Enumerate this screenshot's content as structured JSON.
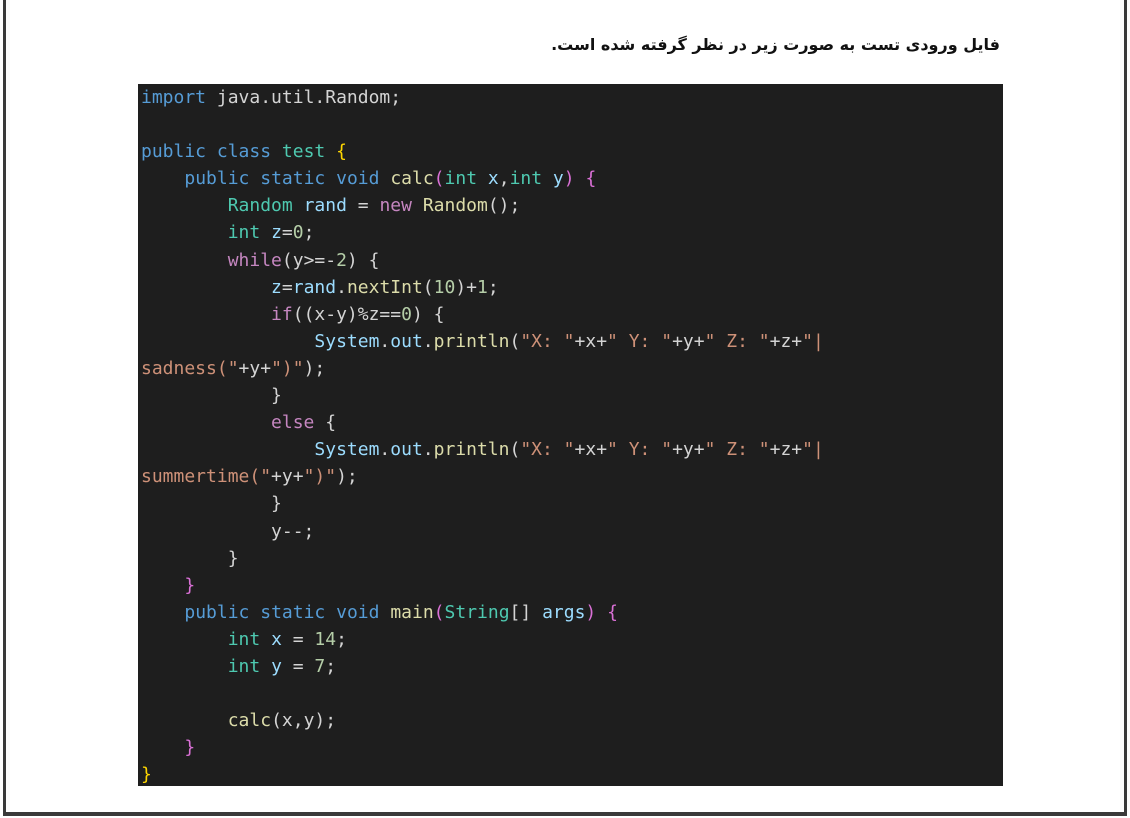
{
  "document": {
    "caption": "فایل ورودی تست به صورت زیر در نظر گرفته شده است."
  },
  "code": {
    "lines": [
      [
        {
          "t": "import",
          "c": "kw"
        },
        {
          "t": " java.util.Random;",
          "c": "punc"
        }
      ],
      [],
      [
        {
          "t": "public",
          "c": "kw"
        },
        {
          "t": " ",
          "c": "punc"
        },
        {
          "t": "class",
          "c": "kw"
        },
        {
          "t": " ",
          "c": "punc"
        },
        {
          "t": "test",
          "c": "type"
        },
        {
          "t": " ",
          "c": "punc"
        },
        {
          "t": "{",
          "c": "brace"
        }
      ],
      [
        {
          "t": "    ",
          "c": "punc"
        },
        {
          "t": "public",
          "c": "kw"
        },
        {
          "t": " ",
          "c": "punc"
        },
        {
          "t": "static",
          "c": "kw"
        },
        {
          "t": " ",
          "c": "punc"
        },
        {
          "t": "void",
          "c": "kw"
        },
        {
          "t": " ",
          "c": "punc"
        },
        {
          "t": "calc",
          "c": "fn"
        },
        {
          "t": "(",
          "c": "paren"
        },
        {
          "t": "int",
          "c": "type"
        },
        {
          "t": " ",
          "c": "punc"
        },
        {
          "t": "x",
          "c": "var"
        },
        {
          "t": ",",
          "c": "punc"
        },
        {
          "t": "int",
          "c": "type"
        },
        {
          "t": " ",
          "c": "punc"
        },
        {
          "t": "y",
          "c": "var"
        },
        {
          "t": ")",
          "c": "paren"
        },
        {
          "t": " ",
          "c": "punc"
        },
        {
          "t": "{",
          "c": "paren"
        }
      ],
      [
        {
          "t": "        ",
          "c": "punc"
        },
        {
          "t": "Random",
          "c": "type"
        },
        {
          "t": " ",
          "c": "punc"
        },
        {
          "t": "rand",
          "c": "var"
        },
        {
          "t": " = ",
          "c": "punc"
        },
        {
          "t": "new",
          "c": "ctrl"
        },
        {
          "t": " ",
          "c": "punc"
        },
        {
          "t": "Random",
          "c": "fn"
        },
        {
          "t": "();",
          "c": "punc"
        }
      ],
      [
        {
          "t": "        ",
          "c": "punc"
        },
        {
          "t": "int",
          "c": "type"
        },
        {
          "t": " ",
          "c": "punc"
        },
        {
          "t": "z",
          "c": "var"
        },
        {
          "t": "=",
          "c": "punc"
        },
        {
          "t": "0",
          "c": "num"
        },
        {
          "t": ";",
          "c": "punc"
        }
      ],
      [
        {
          "t": "        ",
          "c": "punc"
        },
        {
          "t": "while",
          "c": "ctrl"
        },
        {
          "t": "(y>=-",
          "c": "punc"
        },
        {
          "t": "2",
          "c": "num"
        },
        {
          "t": ") {",
          "c": "punc"
        }
      ],
      [
        {
          "t": "            ",
          "c": "punc"
        },
        {
          "t": "z",
          "c": "var"
        },
        {
          "t": "=",
          "c": "punc"
        },
        {
          "t": "rand",
          "c": "var"
        },
        {
          "t": ".",
          "c": "punc"
        },
        {
          "t": "nextInt",
          "c": "fn"
        },
        {
          "t": "(",
          "c": "punc"
        },
        {
          "t": "10",
          "c": "num"
        },
        {
          "t": ")+",
          "c": "punc"
        },
        {
          "t": "1",
          "c": "num"
        },
        {
          "t": ";",
          "c": "punc"
        }
      ],
      [
        {
          "t": "            ",
          "c": "punc"
        },
        {
          "t": "if",
          "c": "ctrl"
        },
        {
          "t": "((x-y)%z==",
          "c": "punc"
        },
        {
          "t": "0",
          "c": "num"
        },
        {
          "t": ") {",
          "c": "punc"
        }
      ],
      [
        {
          "t": "                ",
          "c": "punc"
        },
        {
          "t": "System",
          "c": "var"
        },
        {
          "t": ".",
          "c": "punc"
        },
        {
          "t": "out",
          "c": "var"
        },
        {
          "t": ".",
          "c": "punc"
        },
        {
          "t": "println",
          "c": "fn"
        },
        {
          "t": "(",
          "c": "punc"
        },
        {
          "t": "\"X: \"",
          "c": "str"
        },
        {
          "t": "+x+",
          "c": "punc"
        },
        {
          "t": "\" Y: \"",
          "c": "str"
        },
        {
          "t": "+y+",
          "c": "punc"
        },
        {
          "t": "\" Z: \"",
          "c": "str"
        },
        {
          "t": "+z+",
          "c": "punc"
        },
        {
          "t": "\"|",
          "c": "str"
        }
      ],
      [
        {
          "t": "sadness(\"",
          "c": "str"
        },
        {
          "t": "+y+",
          "c": "punc"
        },
        {
          "t": "\")\"",
          "c": "str"
        },
        {
          "t": ");",
          "c": "punc"
        }
      ],
      [
        {
          "t": "            }",
          "c": "punc"
        }
      ],
      [
        {
          "t": "            ",
          "c": "punc"
        },
        {
          "t": "else",
          "c": "ctrl"
        },
        {
          "t": " {",
          "c": "punc"
        }
      ],
      [
        {
          "t": "                ",
          "c": "punc"
        },
        {
          "t": "System",
          "c": "var"
        },
        {
          "t": ".",
          "c": "punc"
        },
        {
          "t": "out",
          "c": "var"
        },
        {
          "t": ".",
          "c": "punc"
        },
        {
          "t": "println",
          "c": "fn"
        },
        {
          "t": "(",
          "c": "punc"
        },
        {
          "t": "\"X: \"",
          "c": "str"
        },
        {
          "t": "+x+",
          "c": "punc"
        },
        {
          "t": "\" Y: \"",
          "c": "str"
        },
        {
          "t": "+y+",
          "c": "punc"
        },
        {
          "t": "\" Z: \"",
          "c": "str"
        },
        {
          "t": "+z+",
          "c": "punc"
        },
        {
          "t": "\"|",
          "c": "str"
        }
      ],
      [
        {
          "t": "summertime(\"",
          "c": "str"
        },
        {
          "t": "+y+",
          "c": "punc"
        },
        {
          "t": "\")\"",
          "c": "str"
        },
        {
          "t": ");",
          "c": "punc"
        }
      ],
      [
        {
          "t": "            }",
          "c": "punc"
        }
      ],
      [
        {
          "t": "            y--;",
          "c": "punc"
        }
      ],
      [
        {
          "t": "        }",
          "c": "punc"
        }
      ],
      [
        {
          "t": "    ",
          "c": "punc"
        },
        {
          "t": "}",
          "c": "paren"
        }
      ],
      [
        {
          "t": "    ",
          "c": "punc"
        },
        {
          "t": "public",
          "c": "kw"
        },
        {
          "t": " ",
          "c": "punc"
        },
        {
          "t": "static",
          "c": "kw"
        },
        {
          "t": " ",
          "c": "punc"
        },
        {
          "t": "void",
          "c": "kw"
        },
        {
          "t": " ",
          "c": "punc"
        },
        {
          "t": "main",
          "c": "fn"
        },
        {
          "t": "(",
          "c": "paren"
        },
        {
          "t": "String",
          "c": "type"
        },
        {
          "t": "[] ",
          "c": "punc"
        },
        {
          "t": "args",
          "c": "var"
        },
        {
          "t": ")",
          "c": "paren"
        },
        {
          "t": " ",
          "c": "punc"
        },
        {
          "t": "{",
          "c": "paren"
        }
      ],
      [
        {
          "t": "        ",
          "c": "punc"
        },
        {
          "t": "int",
          "c": "type"
        },
        {
          "t": " ",
          "c": "punc"
        },
        {
          "t": "x",
          "c": "var"
        },
        {
          "t": " = ",
          "c": "punc"
        },
        {
          "t": "14",
          "c": "num"
        },
        {
          "t": ";",
          "c": "punc"
        }
      ],
      [
        {
          "t": "        ",
          "c": "punc"
        },
        {
          "t": "int",
          "c": "type"
        },
        {
          "t": " ",
          "c": "punc"
        },
        {
          "t": "y",
          "c": "var"
        },
        {
          "t": " = ",
          "c": "punc"
        },
        {
          "t": "7",
          "c": "num"
        },
        {
          "t": ";",
          "c": "punc"
        }
      ],
      [],
      [
        {
          "t": "        ",
          "c": "punc"
        },
        {
          "t": "calc",
          "c": "fn"
        },
        {
          "t": "(x,y);",
          "c": "punc"
        }
      ],
      [
        {
          "t": "    ",
          "c": "punc"
        },
        {
          "t": "}",
          "c": "paren"
        }
      ],
      [
        {
          "t": "}",
          "c": "brace"
        }
      ]
    ]
  }
}
